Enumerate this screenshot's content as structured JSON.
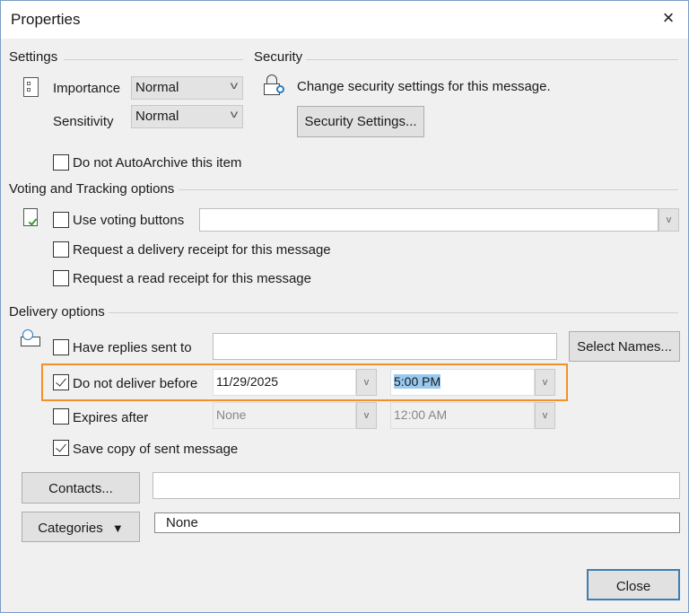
{
  "window": {
    "title": "Properties",
    "close_icon": "×"
  },
  "settings": {
    "heading": "Settings",
    "importance_label": "Importance",
    "importance_value": "Normal",
    "sensitivity_label": "Sensitivity",
    "sensitivity_value": "Normal",
    "autoarchive_label": "Do not AutoArchive this item",
    "autoarchive_checked": false
  },
  "security": {
    "heading": "Security",
    "description": "Change security settings for this message.",
    "button": "Security Settings..."
  },
  "voting": {
    "heading": "Voting and Tracking options",
    "use_voting_label": "Use voting buttons",
    "voting_value": "",
    "delivery_receipt_label": "Request a delivery receipt for this message",
    "read_receipt_label": "Request a read receipt for this message"
  },
  "delivery": {
    "heading": "Delivery options",
    "replies_label": "Have replies sent to",
    "replies_value": "",
    "select_names": "Select Names...",
    "deliver_before_label": "Do not deliver before",
    "deliver_before_checked": true,
    "deliver_date": "11/29/2025",
    "deliver_time": "5:00 PM",
    "expires_label": "Expires after",
    "expires_date": "None",
    "expires_time": "12:00 AM",
    "save_copy_label": "Save copy of sent message",
    "save_copy_checked": true
  },
  "contacts": {
    "button": "Contacts...",
    "value": ""
  },
  "categories": {
    "button": "Categories",
    "value": "None"
  },
  "footer": {
    "close": "Close"
  },
  "colors": {
    "highlight": "#f0912a",
    "close_border": "#3c7fb1"
  }
}
